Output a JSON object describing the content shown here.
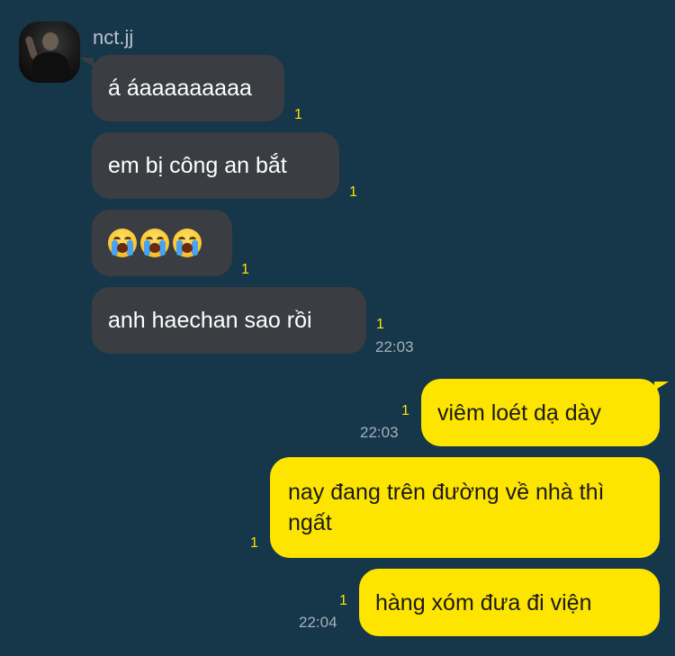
{
  "chat": {
    "sender": {
      "name": "nct.jj"
    },
    "incoming": [
      {
        "text": "á áaaaaaaaaa",
        "unread": "1"
      },
      {
        "text": "em bị công an bắt",
        "unread": "1"
      },
      {
        "emoji": [
          "loudly-crying-face-icon",
          "loudly-crying-face-icon",
          "loudly-crying-face-icon"
        ],
        "unread": "1"
      },
      {
        "text": "anh haechan sao rồi",
        "unread": "1",
        "time": "22:03"
      }
    ],
    "outgoing": [
      {
        "text": "viêm loét dạ dày",
        "unread": "1",
        "time": "22:03"
      },
      {
        "text": "nay đang trên đường về nhà thì ngất",
        "unread": "1"
      },
      {
        "text": "hàng xóm đưa đi viện",
        "unread": "1",
        "time": "22:04"
      }
    ]
  },
  "colors": {
    "background": "#16364a",
    "incoming_bubble": "#3a3d42",
    "outgoing_bubble": "#fee500",
    "unread_count": "#fee500",
    "timestamp": "#a7b0b9"
  }
}
